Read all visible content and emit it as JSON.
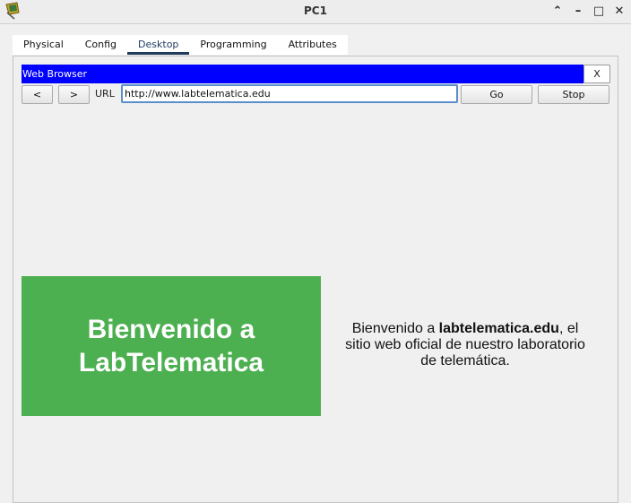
{
  "window": {
    "title": "PC1",
    "controls": {
      "minimize_chevron": "⌃",
      "minimize": "–",
      "maximize": "□",
      "close": "✕"
    }
  },
  "tabs": [
    {
      "label": "Physical",
      "active": false
    },
    {
      "label": "Config",
      "active": false
    },
    {
      "label": "Desktop",
      "active": true
    },
    {
      "label": "Programming",
      "active": false
    },
    {
      "label": "Attributes",
      "active": false
    }
  ],
  "browser": {
    "title": "Web Browser",
    "close_label": "X",
    "back_label": "<",
    "forward_label": ">",
    "url_label": "URL",
    "url_value": "http://www.labtelematica.edu",
    "go_label": "Go",
    "stop_label": "Stop"
  },
  "page": {
    "hero_line1": "Bienvenido a",
    "hero_line2": "LabTelematica",
    "hero_color": "#4caf50",
    "desc_prefix": "Bienvenido a ",
    "desc_bold": "labtelematica.edu",
    "desc_suffix": ", el sitio web oficial de nuestro laboratorio de telemática."
  },
  "colors": {
    "browser_title_bg": "#0000ff",
    "tab_active_underline": "#1f3a5a",
    "background": "#f0f0f0"
  }
}
